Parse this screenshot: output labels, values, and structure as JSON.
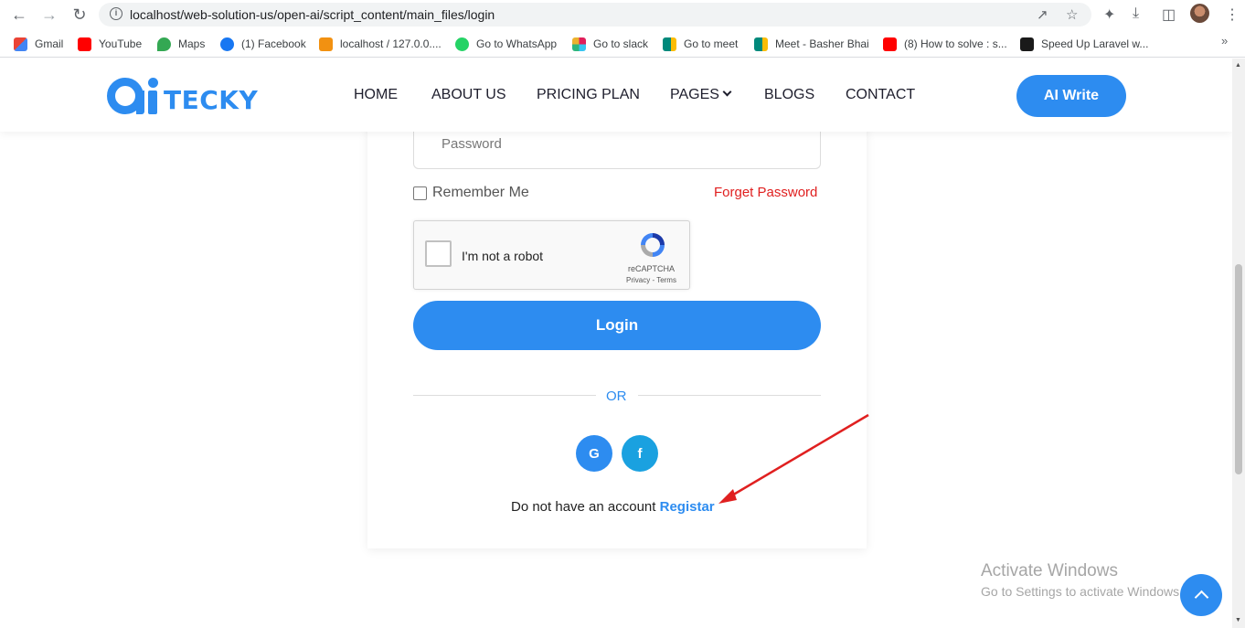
{
  "browser": {
    "url": "localhost/web-solution-us/open-ai/script_content/main_files/login",
    "bookmarks": [
      {
        "label": "Gmail",
        "icon": "gmail-icon",
        "color": "#ea4335"
      },
      {
        "label": "YouTube",
        "icon": "youtube-icon",
        "color": "#ff0000"
      },
      {
        "label": "Maps",
        "icon": "maps-icon",
        "color": "#34a853"
      },
      {
        "label": "(1) Facebook",
        "icon": "facebook-icon",
        "color": "#1877f2"
      },
      {
        "label": "localhost / 127.0.0....",
        "icon": "phpmyadmin-icon",
        "color": "#f29111"
      },
      {
        "label": "Go to WhatsApp",
        "icon": "whatsapp-icon",
        "color": "#25d366"
      },
      {
        "label": "Go to slack",
        "icon": "slack-icon",
        "color": "#e01e5a"
      },
      {
        "label": "Go to meet",
        "icon": "meet-icon",
        "color": "#00897b"
      },
      {
        "label": "Meet - Basher Bhai",
        "icon": "meet-icon",
        "color": "#00897b"
      },
      {
        "label": "(8) How to solve : s...",
        "icon": "youtube-icon",
        "color": "#ff0000"
      },
      {
        "label": "Speed Up Laravel w...",
        "icon": "laravel-icon",
        "color": "#1a1a1a"
      }
    ]
  },
  "header": {
    "logo_text": "TECKY",
    "nav": [
      "HOME",
      "ABOUT US",
      "PRICING PLAN",
      "PAGES",
      "BLOGS",
      "CONTACT"
    ],
    "cta": "AI Write"
  },
  "form": {
    "password_placeholder": "Password",
    "remember_label": "Remember Me",
    "forget_label": "Forget Password",
    "captcha_label": "I'm not a robot",
    "captcha_brand": "reCAPTCHA",
    "captcha_terms": "Privacy - Terms",
    "login_label": "Login",
    "or_label": "OR",
    "google_label": "G",
    "facebook_label": "f",
    "register_prompt": "Do not have an account",
    "register_link": "Registar"
  },
  "os": {
    "watermark_title": "Activate Windows",
    "watermark_sub": "Go to Settings to activate Windows."
  },
  "colors": {
    "accent": "#2d8cf0",
    "danger": "#e02020",
    "annotation_arrow": "#e02020"
  }
}
